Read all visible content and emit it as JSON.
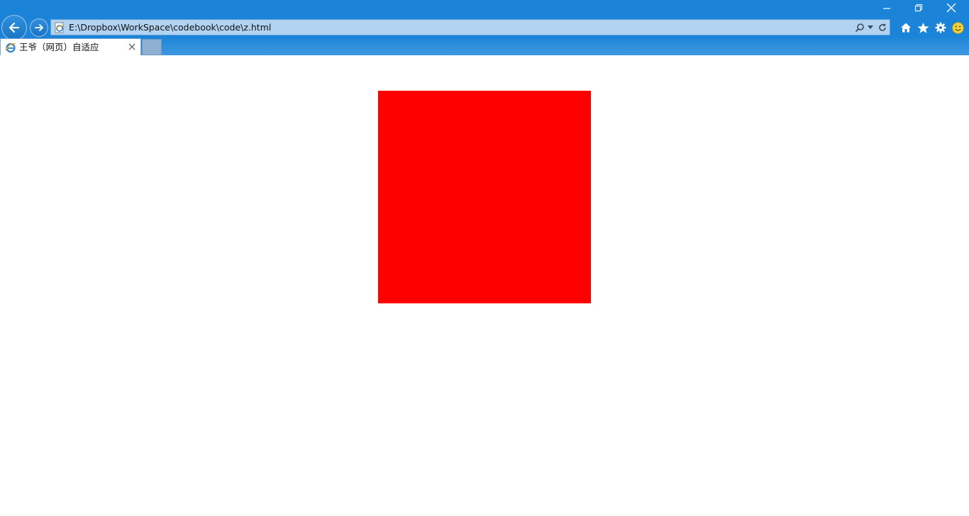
{
  "window": {
    "minimize_icon": "minimize-icon",
    "restore_icon": "restore-icon",
    "close_icon": "close-icon"
  },
  "navigation": {
    "back_icon": "arrow-left-icon",
    "forward_icon": "arrow-right-icon"
  },
  "address_bar": {
    "url": "E:\\Dropbox\\WorkSpace\\codebook\\code\\z.html",
    "favicon": "ie-page-icon",
    "search_icon": "search-icon",
    "dropdown_icon": "chevron-down-icon",
    "refresh_icon": "refresh-icon"
  },
  "toolbar": {
    "icons": [
      "home-icon",
      "star-icon",
      "gear-icon",
      "smiley-icon"
    ]
  },
  "tabs": [
    {
      "title": "王爷（网页）自适应",
      "icon": "ie-logo-icon",
      "active": true
    }
  ],
  "page": {
    "box_color": "#ff0000"
  },
  "colors": {
    "chrome": "#1c84d8",
    "address_bg": "#b1d3f1",
    "content_bg": "#ffffff"
  }
}
